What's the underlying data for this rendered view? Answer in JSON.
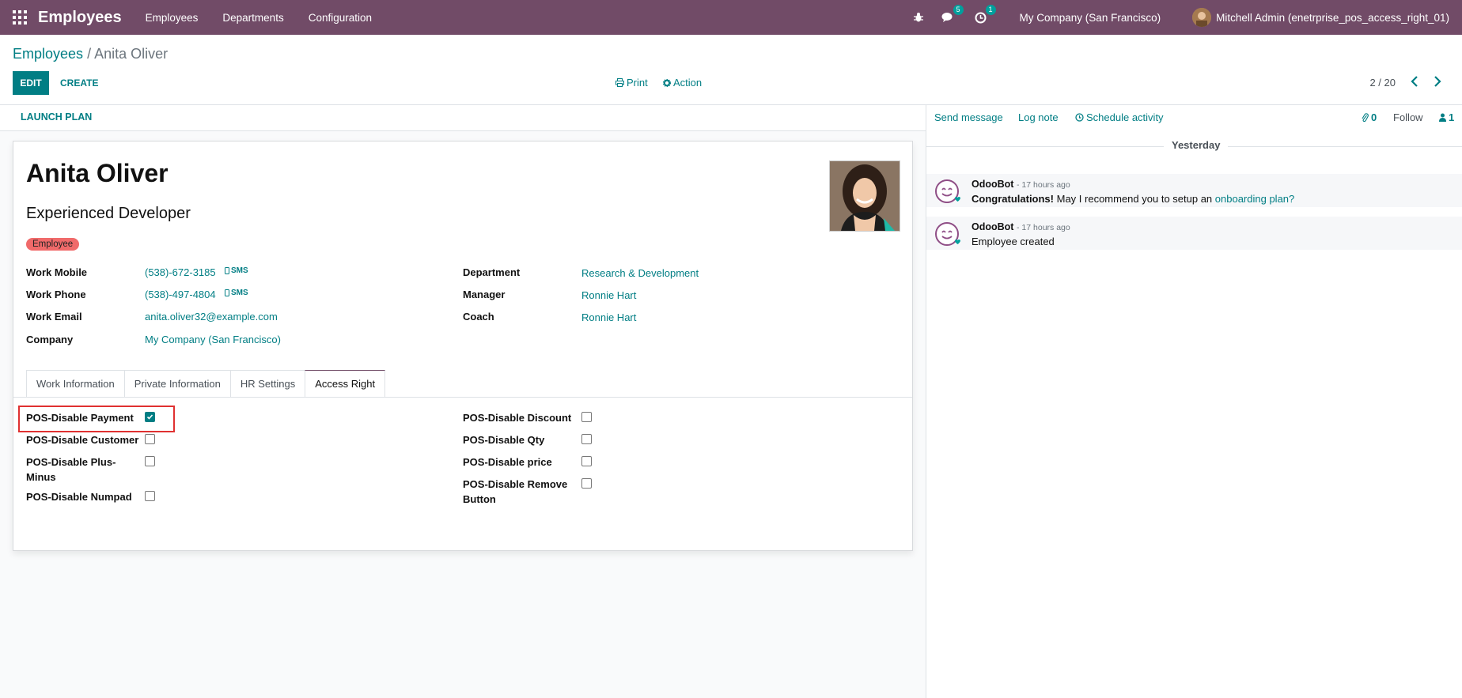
{
  "navbar": {
    "app_title": "Employees",
    "menu": [
      "Employees",
      "Departments",
      "Configuration"
    ],
    "messages_badge": "5",
    "activities_badge": "1",
    "company": "My Company (San Francisco)",
    "user": "Mitchell Admin (enetrprise_pos_access_right_01)",
    "color": "#714b67"
  },
  "control_panel": {
    "breadcrumb_parent": "Employees",
    "breadcrumb_sep": "/",
    "breadcrumb_current": "Anita Oliver",
    "edit_label": "EDIT",
    "create_label": "CREATE",
    "print_label": "Print",
    "action_label": "Action",
    "pager": "2 / 20"
  },
  "statusbar": {
    "launch_plan": "LAUNCH PLAN"
  },
  "employee": {
    "name": "Anita Oliver",
    "job_title": "Experienced Developer",
    "tag": "Employee",
    "sms_label": "SMS",
    "left_fields": [
      {
        "label": "Work Mobile",
        "value": "(538)-672-3185"
      },
      {
        "label": "Work Phone",
        "value": "(538)-497-4804"
      },
      {
        "label": "Work Email",
        "value": "anita.oliver32@example.com"
      },
      {
        "label": "Company",
        "value": "My Company (San Francisco)"
      }
    ],
    "right_fields": [
      {
        "label": "Department",
        "value": "Research & Development"
      },
      {
        "label": "Manager",
        "value": "Ronnie Hart"
      },
      {
        "label": "Coach",
        "value": "Ronnie Hart"
      }
    ]
  },
  "tabs": [
    "Work Information",
    "Private Information",
    "HR Settings",
    "Access Right"
  ],
  "active_tab": "Access Right",
  "access_rights": {
    "left": [
      {
        "label": "POS-Disable Payment",
        "checked": true
      },
      {
        "label": "POS-Disable Customer",
        "checked": false
      },
      {
        "label": "POS-Disable Plus-Minus",
        "checked": false
      },
      {
        "label": "POS-Disable Numpad",
        "checked": false
      }
    ],
    "right": [
      {
        "label": "POS-Disable Discount",
        "checked": false
      },
      {
        "label": "POS-Disable Qty",
        "checked": false
      },
      {
        "label": "POS-Disable price",
        "checked": false
      },
      {
        "label": "POS-Disable Remove Button",
        "checked": false
      }
    ]
  },
  "chatter": {
    "send_message": "Send message",
    "log_note": "Log note",
    "schedule_activity": "Schedule activity",
    "attachments": "0",
    "follow": "Follow",
    "followers": "1",
    "day": "Yesterday",
    "messages": [
      {
        "author": "OdooBot",
        "time": "- 17 hours ago",
        "bold": "Congratulations!",
        "text": " May I recommend you to setup an ",
        "link": "onboarding plan?"
      },
      {
        "author": "OdooBot",
        "time": "- 17 hours ago",
        "bold": "",
        "text": "Employee created",
        "link": ""
      }
    ]
  }
}
